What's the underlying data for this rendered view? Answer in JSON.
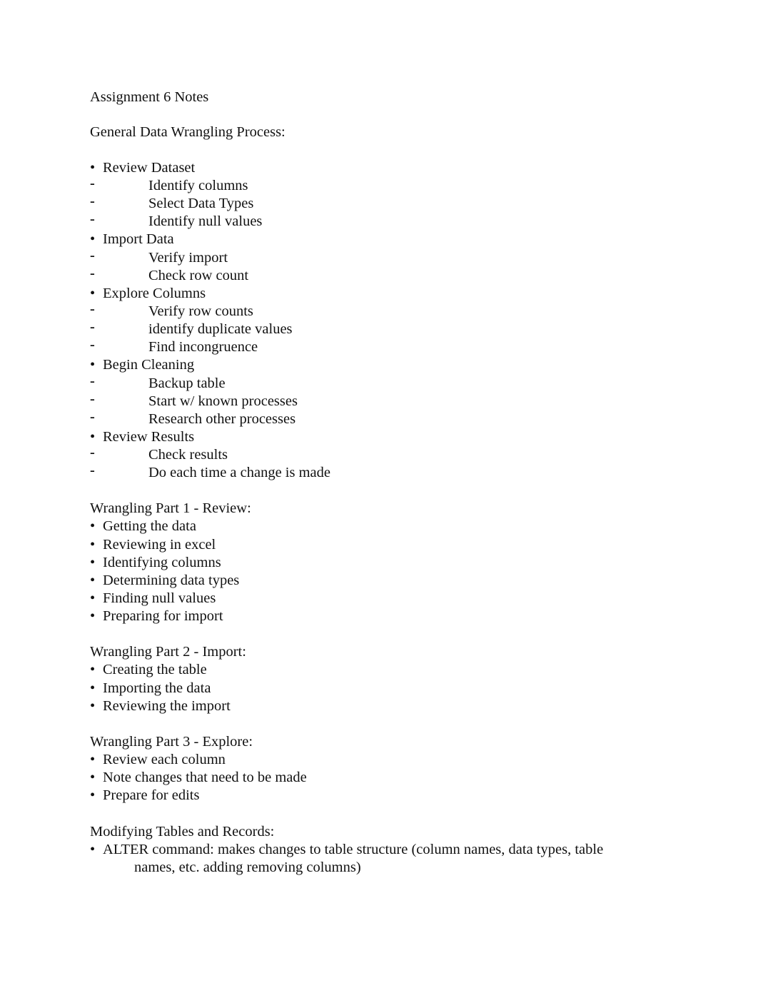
{
  "title": "Assignment 6 Notes",
  "general": {
    "heading": "General Data Wrangling Process:",
    "steps": [
      {
        "label": "Review Dataset",
        "subs": [
          "Identify columns",
          "Select Data Types",
          "Identify null values"
        ]
      },
      {
        "label": "Import Data",
        "subs": [
          "Verify import",
          "Check row count"
        ]
      },
      {
        "label": "Explore Columns",
        "subs": [
          "Verify row counts",
          "identify duplicate values",
          "Find incongruence"
        ]
      },
      {
        "label": "Begin Cleaning",
        "subs": [
          "Backup table",
          "Start w/ known processes",
          "Research other processes"
        ]
      },
      {
        "label": "Review Results",
        "subs": [
          "Check results",
          "Do each time a change is made"
        ]
      }
    ]
  },
  "part1": {
    "heading": "Wrangling Part 1 - Review:",
    "items": [
      "Getting the data",
      "Reviewing in excel",
      "Identifying columns",
      "Determining data types",
      "Finding null values",
      "Preparing for import"
    ]
  },
  "part2": {
    "heading": "Wrangling Part 2 - Import:",
    "items": [
      "Creating the table",
      "Importing the data",
      "Reviewing the import"
    ]
  },
  "part3": {
    "heading": "Wrangling Part 3 - Explore:",
    "items": [
      "Review each column",
      "Note changes that need to be made",
      "Prepare for edits"
    ]
  },
  "modifying": {
    "heading": "Modifying Tables and Records:",
    "items": [
      {
        "line1": "ALTER command: makes changes to table structure (column names, data types, table",
        "line2": "names, etc. adding removing columns)"
      }
    ]
  },
  "glyphs": {
    "bullet": "•",
    "dash": "-"
  }
}
